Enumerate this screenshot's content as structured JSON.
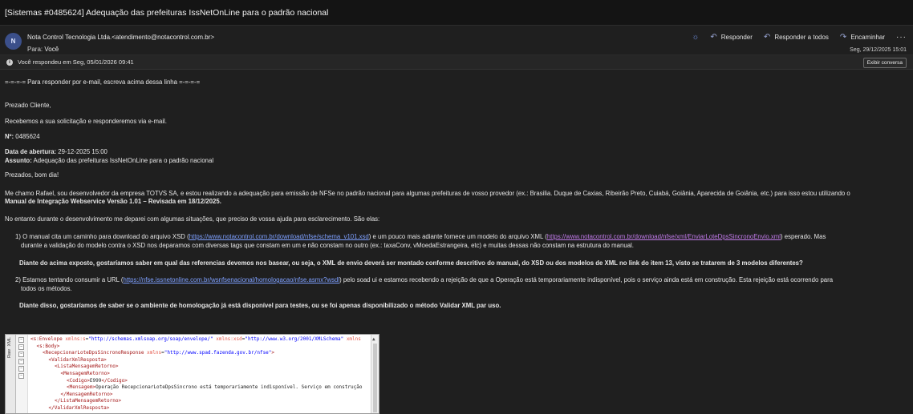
{
  "window": {
    "title": "[Sistemas #0485624] Adequação das prefeituras IssNetOnLine para o padrão nacional"
  },
  "header": {
    "avatar": "N",
    "sender": "Nota Control Tecnologia Ltda.<atendimento@notacontrol.com.br>",
    "to_label": "Para:",
    "to_value": "Você",
    "date": "Seg, 29/12/2025 15:01",
    "actions": {
      "reply": "Responder",
      "reply_all": "Responder a todos",
      "forward": "Encaminhar",
      "more": "···"
    }
  },
  "infobar": {
    "text": "Você respondeu em Seg, 05/01/2026 09:41",
    "button": "Exibir conversa"
  },
  "body": {
    "separator": "=-=-=-= Para responder por e-mail, escreva acima dessa linha =-=-=-=",
    "greeting": "Prezado Cliente,",
    "received": "Recebemos a sua solicitação e responderemos via e-mail.",
    "num_label": "Nº:",
    "num_value": " 0485624",
    "open_label": "Data de abertura:",
    "open_value": " 29-12-2025 15:00",
    "subject_label": "Assunto:",
    "subject_value": " Adequação das prefeituras IssNetOnLine para o padrão nacional",
    "salutation": "Prezados, bom dia!",
    "intro_1": "Me chamo Rafael, sou desenvolvedor da empresa TOTVS SA, e estou realizando a adequação para emissão de NFSe no padrão nacional para algumas prefeituras de vosso provedor (ex.: Brasilia. Duque de Caxias, Ribeirão Preto, Cuiabá, Goiânia, Aparecida de Goiânia, etc.) para isso estou utilizando o",
    "intro_2": "Manual de Integração Webservice Versão 1.01 – Revisada em 18/12/2025.",
    "situations": "No entanto durante o desenvolvimento me deparei com algumas situações, que preciso de vossa ajuda para esclarecimento. São elas:",
    "item1_a": "1) O manual cita um caminho para download do arquivo XSD (",
    "item1_link1": "https://www.notacontrol.com.br/download/nfse/schema_v101.xsd",
    "item1_b": ") e um pouco mais adiante fornece um modelo do arquivo XML (",
    "item1_link2": "https://www.notacontrol.com.br/download/nfse/xml/EnviarLoteDpsSincronoEnvio.xml",
    "item1_c": ") esperado. Mas",
    "item1_line2": "durante a validação do modelo contra o XSD nos deparamos com diversas tags que constam em um e não constam no outro (ex.:  taxaConv, vMoedaEstrangeira, etc) e muitas dessas não constam na estrutura do manual.",
    "question1": "Diante do acima exposto, gostaríamos saber em qual das referencias devemos nos basear, ou seja, o XML de envio deverá ser montado conforme descritivo do manual, do XSD ou dos modelos de XML no link do item 13, visto se tratarem de 3 modelos diferentes?",
    "item2_a": "2) Estamos tentando consumir a URL (",
    "item2_link": "https://nfse.issnetonline.com.br/wsnfsenacional/homologacao/nfse.asmx?wsdl",
    "item2_b": ") pelo soad ui e estamos recebendo a rejeição de que a Operação está temporariamente indisponível, pois o serviço ainda está em construção. Esta rejeição está ocorrendo para",
    "item2_line2": "todos os métodos.",
    "question2": "Diante disso, gostaríamos de saber se o ambiente de homologação já está disponível para testes, ou se foi apenas disponibilizado o método Validar XML par uso."
  },
  "xml": {
    "tab_raw": "Raw",
    "tab_xml": "XML",
    "lines": [
      {
        "indent": 0,
        "parts": [
          [
            "tag",
            "<s:Envelope"
          ],
          [
            "at",
            " xmlns:s"
          ],
          [
            "tx",
            "="
          ],
          [
            "av",
            "\"http://schemas.xmlsoap.org/soap/envelope/\""
          ],
          [
            "at",
            " xmlns:xsd"
          ],
          [
            "tx",
            "="
          ],
          [
            "av",
            "\"http://www.w3.org/2001/XMLSchema\""
          ],
          [
            "at",
            " xmlns"
          ]
        ]
      },
      {
        "indent": 1,
        "parts": [
          [
            "tag",
            "<s:Body>"
          ]
        ]
      },
      {
        "indent": 2,
        "parts": [
          [
            "tag",
            "<RecepcionarLoteDpsSincronoResponse"
          ],
          [
            "at",
            " xmlns"
          ],
          [
            "tx",
            "="
          ],
          [
            "av",
            "\"http://www.spad.fazenda.gov.br/nfse\""
          ],
          [
            "tag",
            ">"
          ]
        ]
      },
      {
        "indent": 3,
        "parts": [
          [
            "tag",
            "<ValidarXmlResposta>"
          ]
        ]
      },
      {
        "indent": 4,
        "parts": [
          [
            "tag",
            "<ListaMensagemRetorno>"
          ]
        ]
      },
      {
        "indent": 5,
        "parts": [
          [
            "tag",
            "<MensagemRetorno>"
          ]
        ]
      },
      {
        "indent": 6,
        "parts": [
          [
            "tag",
            "<Codigo>"
          ],
          [
            "tx",
            "E999"
          ],
          [
            "tag",
            "</Codigo>"
          ]
        ]
      },
      {
        "indent": 6,
        "parts": [
          [
            "tag",
            "<Mensagem>"
          ],
          [
            "tx",
            "Operação RecepcionarLoteDpsSincrono está temporariamente indisponível. Serviço em construção"
          ]
        ]
      },
      {
        "indent": 5,
        "parts": [
          [
            "tag",
            "</MensagemRetorno>"
          ]
        ]
      },
      {
        "indent": 4,
        "parts": [
          [
            "tag",
            "</ListaMensagemRetorno>"
          ]
        ]
      },
      {
        "indent": 3,
        "parts": [
          [
            "tag",
            "</ValidarXmlResposta>"
          ]
        ]
      }
    ]
  }
}
